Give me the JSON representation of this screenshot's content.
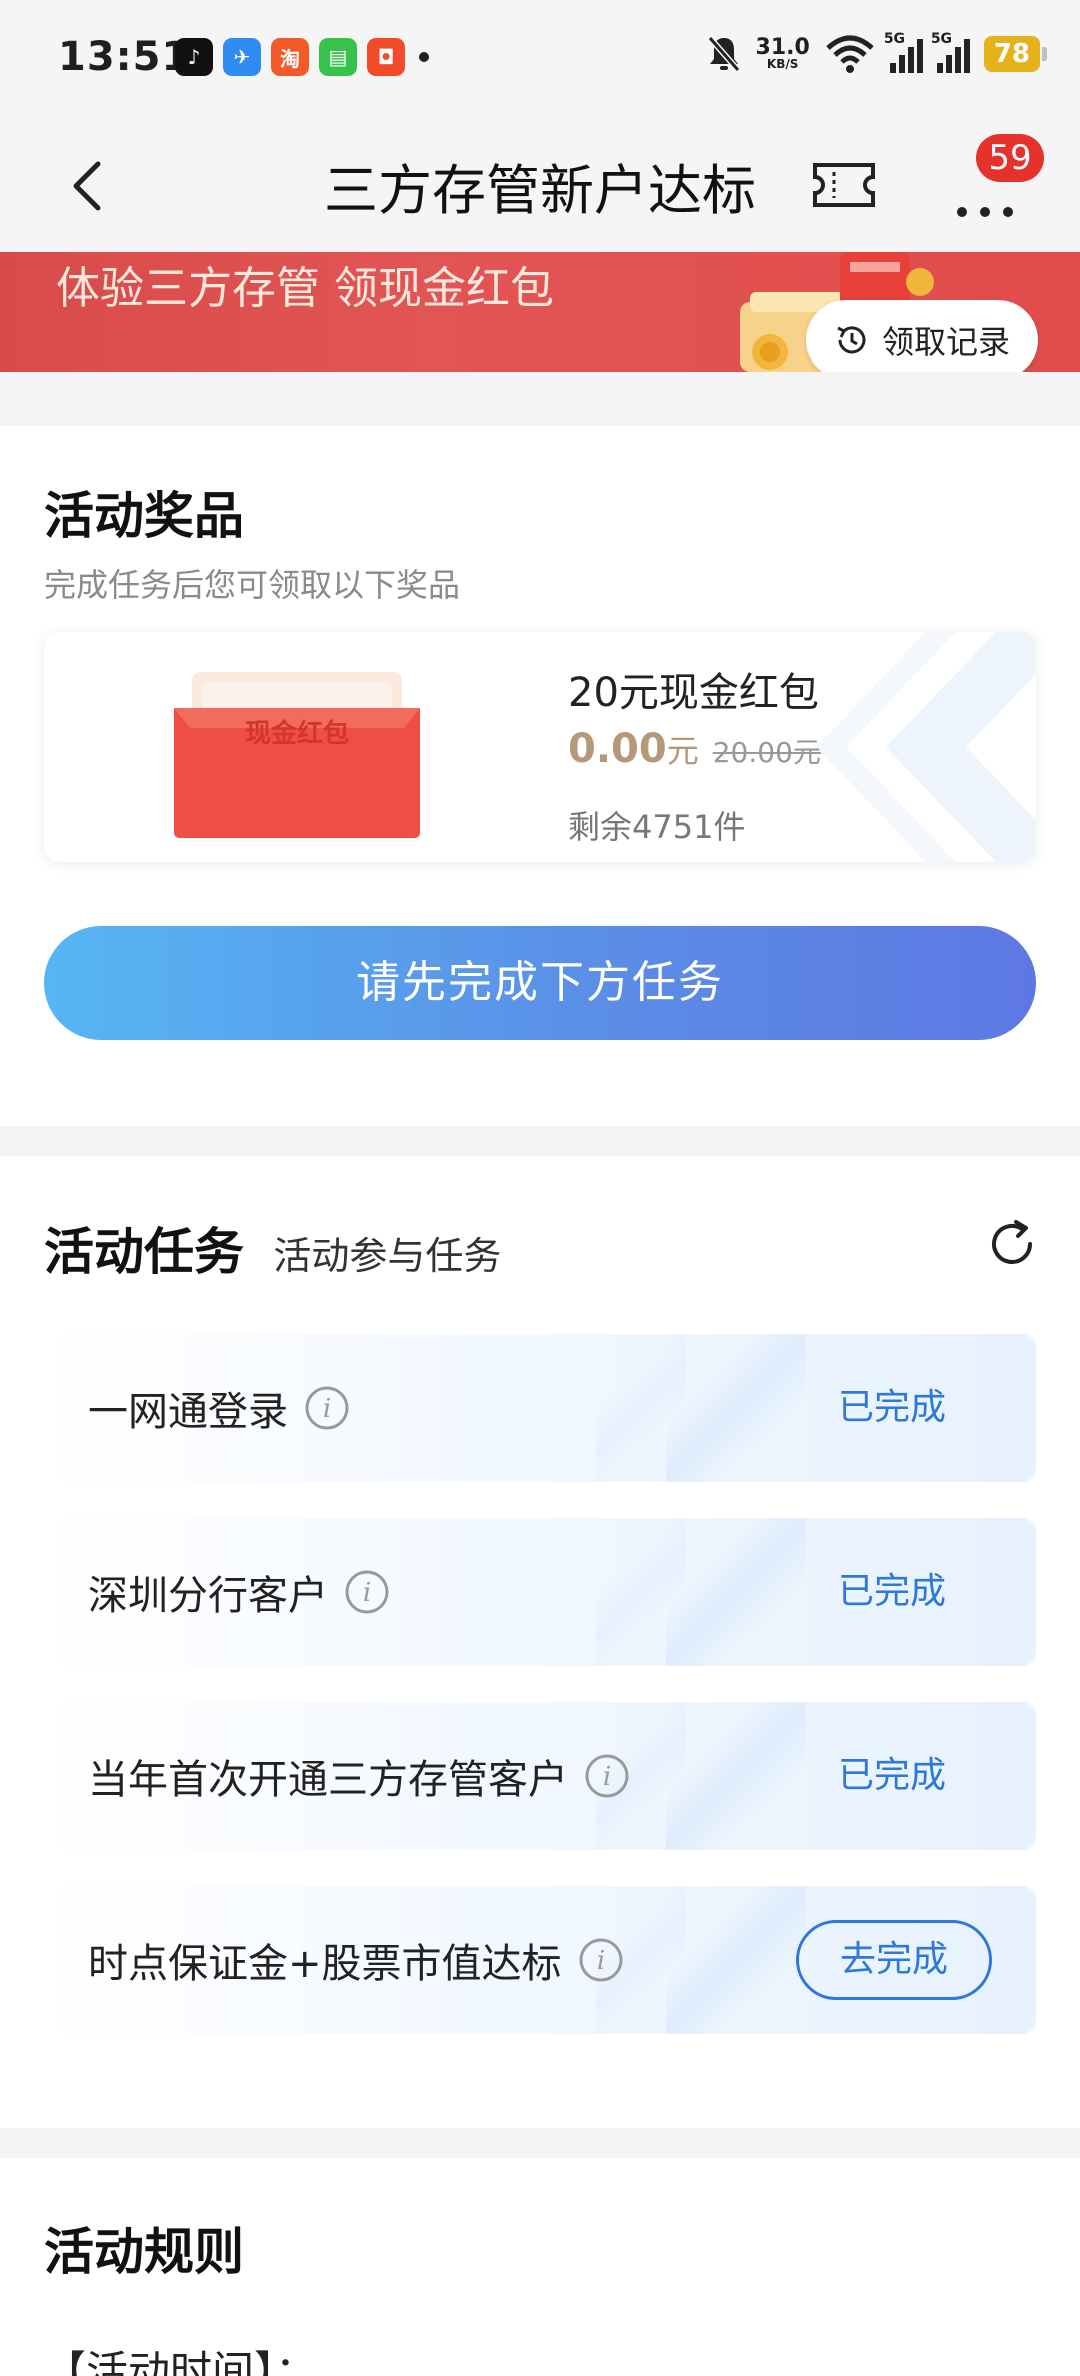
{
  "status_bar": {
    "time": "13:51",
    "net_speed": "31.0",
    "net_unit": "KB/S",
    "signal1": "5G",
    "signal2": "5G",
    "battery": "78",
    "apps": [
      {
        "icon": "tiktok-icon",
        "color": "#111111",
        "glyph": "♪"
      },
      {
        "icon": "feishu-icon",
        "color": "#2f8cf0",
        "glyph": "✈"
      },
      {
        "icon": "taobao-icon",
        "color": "#f25a2a",
        "glyph": "淘"
      },
      {
        "icon": "message-icon",
        "color": "#37c24c",
        "glyph": "▤"
      },
      {
        "icon": "meituan-icon",
        "color": "#f24b2a",
        "glyph": "◘"
      }
    ]
  },
  "nav": {
    "title": "三方存管新户达标",
    "badge": "59"
  },
  "banner": {
    "text": "体验三方存管 领现金红包",
    "record_label": "领取记录"
  },
  "prize_section": {
    "title": "活动奖品",
    "subtitle": "完成任务后您可领取以下奖品",
    "prize": {
      "image_text": "现金红包",
      "name": "20元现金红包",
      "price": "0.00",
      "unit": "元",
      "original_price": "20.00元",
      "stock": "剩余4751件"
    },
    "button_label": "请先完成下方任务"
  },
  "task_section": {
    "title": "活动任务",
    "subtitle": "活动参与任务",
    "tasks": [
      {
        "name": "一网通登录",
        "status": "已完成"
      },
      {
        "name": "深圳分行客户",
        "status": "已完成"
      },
      {
        "name": "当年首次开通三方存管客户",
        "status": "已完成"
      },
      {
        "name": "时点保证金+股票市值达标",
        "action": "去完成"
      }
    ]
  },
  "rules_section": {
    "title": "活动规则",
    "first_item": "【活动时间】："
  },
  "colors": {
    "accent_blue": "#2d78d8",
    "badge_red": "#e5322d",
    "banner_red": "#e14c4c",
    "price_gold": "#b5977a"
  }
}
